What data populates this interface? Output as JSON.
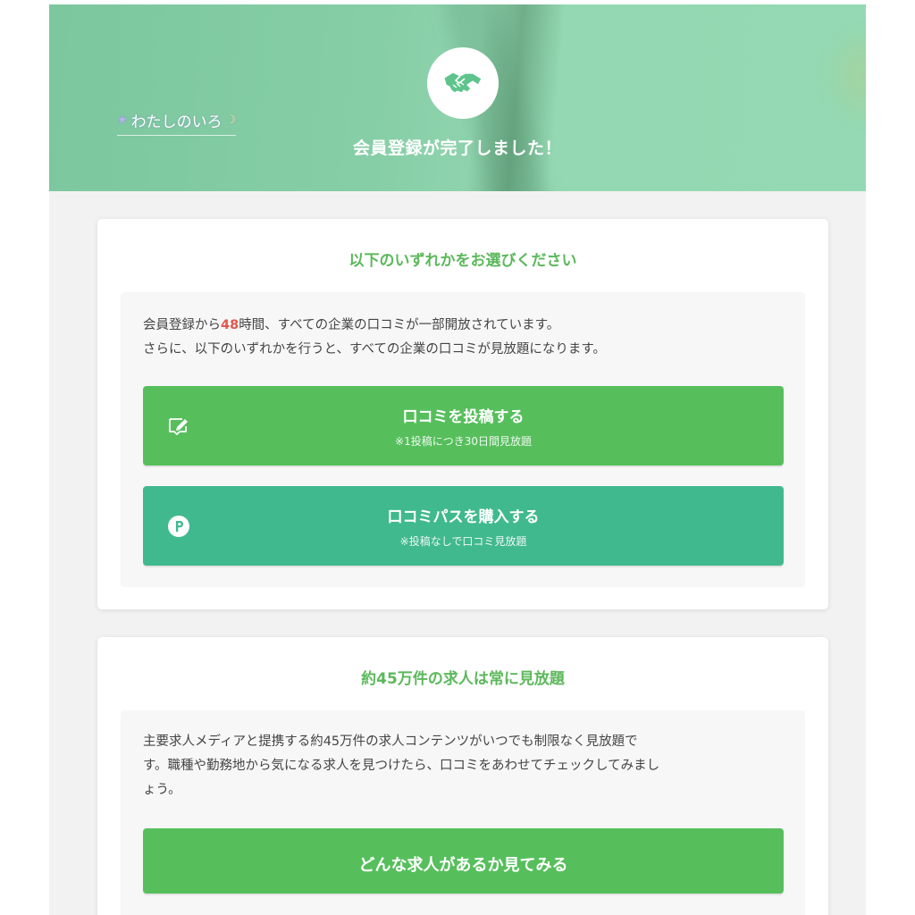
{
  "hero": {
    "title": "会員登録が完了しました！",
    "icon": "handshake-icon",
    "watermark": "わたしのいろ"
  },
  "card1": {
    "title": "以下のいずれかをお選びください",
    "desc_part1": "会員登録から",
    "desc_highlight": "48",
    "desc_part2": "時間、すべての企業の口コミが一部開放されています。",
    "desc_line2": "さらに、以下のいずれかを行うと、すべての企業の口コミが見放題になります。",
    "btn_post": {
      "label": "口コミを投稿する",
      "note": "※1投稿につき30日間見放題",
      "icon": "edit-icon"
    },
    "btn_pass": {
      "label": "口コミパスを購入する",
      "note": "※投稿なしで口コミ見放題",
      "icon": "p-coin-icon"
    }
  },
  "card2": {
    "title": "約45万件の求人は常に見放題",
    "desc_line1": "主要求人メディアと提携する約45万件の求人コンテンツがいつでも制限なく見放題で",
    "desc_line2": "す。職種や勤務地から気になる求人を見つけたら、口コミをあわせてチェックしてみまし",
    "desc_line3": "ょう。",
    "btn_jobs": {
      "label": "どんな求人があるか見てみる"
    }
  },
  "colors": {
    "accent_green": "#5cb85c",
    "button_green": "#56bf5c",
    "button_teal": "#40b98f",
    "highlight_red": "#e2574c",
    "hero_green": "#86cea6"
  }
}
